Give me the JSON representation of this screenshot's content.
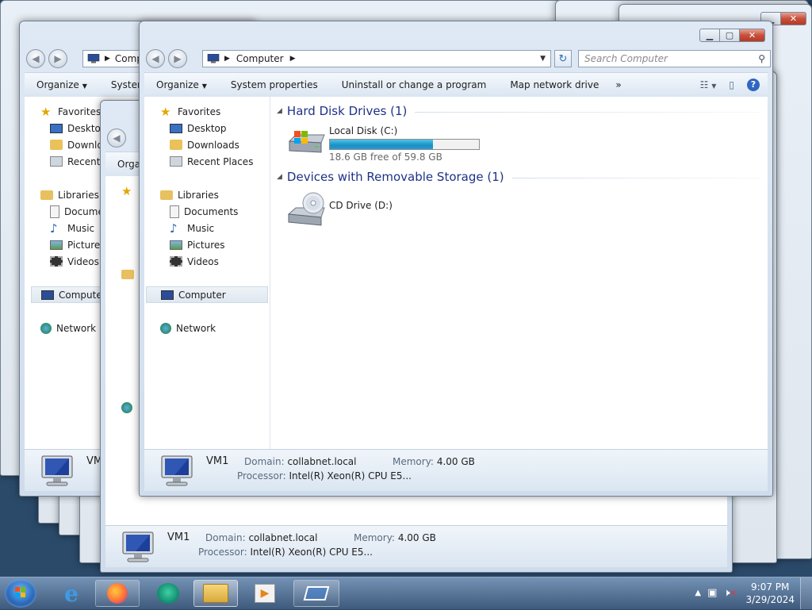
{
  "explorer": {
    "address_root": "Computer",
    "search_placeholder": "Search Computer",
    "toolbar": {
      "organize": "Organize",
      "system_properties": "System properties",
      "uninstall": "Uninstall or change a program",
      "map_drive": "Map network drive",
      "more": "»"
    },
    "nav": {
      "favorites": "Favorites",
      "desktop": "Desktop",
      "downloads": "Downloads",
      "recent_places": "Recent Places",
      "libraries": "Libraries",
      "documents": "Documents",
      "music": "Music",
      "pictures": "Pictures",
      "videos": "Videos",
      "computer": "Computer",
      "network": "Network"
    },
    "groups": {
      "hard_disk": "Hard Disk Drives (1)",
      "removable": "Devices with Removable Storage (1)"
    },
    "drives": {
      "c_name": "Local Disk (C:)",
      "c_free": "18.6 GB free of 59.8 GB",
      "c_used_fraction": 0.69,
      "d_name": "CD Drive (D:)"
    },
    "details": {
      "computer_name": "VM1",
      "domain_label": "Domain:",
      "domain_value": "collabnet.local",
      "memory_label": "Memory:",
      "memory_value": "4.00 GB",
      "processor_label": "Processor:",
      "processor_value": "Intel(R) Xeon(R) CPU E5..."
    }
  },
  "back_window_1": {
    "address_root": "Comp",
    "organize": "Organize",
    "system": "Systen",
    "nav": {
      "favorites": "Favorites",
      "desktop": "Desktop",
      "downloads": "Downlo",
      "recent": "Recent P",
      "libraries": "Libraries",
      "documents": "Docume",
      "music": "Music",
      "pictures": "Pictures",
      "videos": "Videos",
      "computer": "Compute",
      "network": "Network"
    },
    "computer_name": "VM"
  },
  "back_window_2": {
    "organize": "Orga",
    "computer_name": "VM1",
    "domain_label": "Domain:",
    "domain_value": "collabnet.local",
    "memory_label": "Memory:",
    "memory_value": "4.00 GB",
    "processor_label": "Processor:",
    "processor_value": "Intel(R) Xeon(R) CPU E5..."
  },
  "taskbar": {
    "time": "9:07 PM",
    "date": "3/29/2024"
  }
}
